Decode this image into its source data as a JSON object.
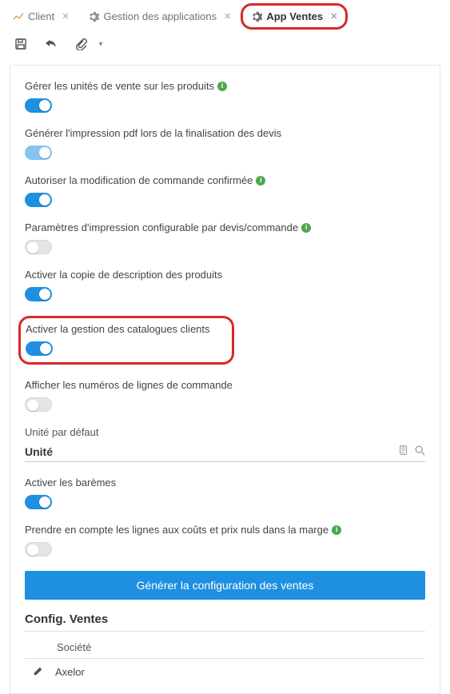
{
  "tabs": [
    {
      "icon": "chart-icon",
      "label": "Client",
      "active": false
    },
    {
      "icon": "gear-icon",
      "label": "Gestion des applications",
      "active": false
    },
    {
      "icon": "gear-icon",
      "label": "App Ventes",
      "active": true,
      "highlight": true
    }
  ],
  "settings": {
    "manage_units": {
      "label": "Gérer les unités de vente sur les produits",
      "info": true,
      "on": true,
      "locked": false
    },
    "generate_pdf": {
      "label": "Générer l'impression pdf lors de la finalisation des devis",
      "info": false,
      "on": true,
      "locked": true
    },
    "allow_modify": {
      "label": "Autoriser la modification de commande confirmée",
      "info": true,
      "on": true,
      "locked": false
    },
    "print_params": {
      "label": "Paramètres d'impression configurable par devis/commande",
      "info": true,
      "on": false,
      "locked": false
    },
    "copy_desc": {
      "label": "Activer la copie de description des produits",
      "info": false,
      "on": true,
      "locked": false
    },
    "catalogues": {
      "label": "Activer la gestion des catalogues clients",
      "info": false,
      "on": true,
      "locked": false,
      "highlight": true
    },
    "show_line_nums": {
      "label": "Afficher les numéros de lignes de commande",
      "info": false,
      "on": false,
      "locked": false
    },
    "default_unit_label": "Unité par défaut",
    "default_unit_value": "Unité",
    "enable_scales": {
      "label": "Activer les barèmes",
      "info": false,
      "on": true,
      "locked": false
    },
    "null_cost_margin": {
      "label": "Prendre en compte les lignes aux coûts et prix nuls dans la marge",
      "info": true,
      "on": false,
      "locked": false
    }
  },
  "generate_button": "Générer la configuration des ventes",
  "config_section": {
    "title": "Config. Ventes",
    "column": "Société",
    "rows": [
      {
        "value": "Axelor"
      }
    ]
  }
}
